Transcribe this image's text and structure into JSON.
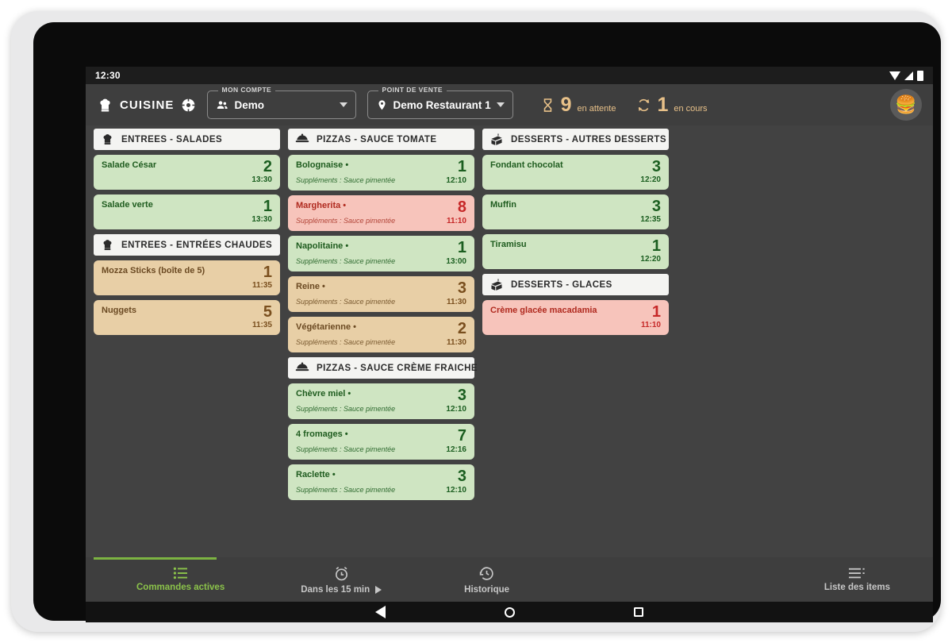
{
  "status_bar": {
    "clock": "12:30",
    "icons": [
      "wifi-icon",
      "signal-icon",
      "battery-icon"
    ]
  },
  "header": {
    "brand": "CUISINE",
    "brand_icon": "chef-hat-icon",
    "status_icon": "connection-target-icon",
    "account": {
      "label": "MON COMPTE",
      "value": "Demo",
      "icon": "people-icon"
    },
    "point_of_sale": {
      "label": "POINT DE VENTE",
      "value": "Demo Restaurant 1",
      "icon": "location-pin-icon"
    },
    "counters": [
      {
        "icon": "hourglass-icon",
        "count": "9",
        "caption": "en attente"
      },
      {
        "icon": "refresh-cycle-icon",
        "count": "1",
        "caption": "en cours"
      }
    ],
    "avatar": "🍔",
    "accent_color": "#e8c189"
  },
  "board": {
    "columns": [
      {
        "sections": [
          {
            "title": "ENTREES - SALADES",
            "icon": "chef-hat-icon",
            "cards": [
              {
                "name": "Salade César",
                "qty": "2",
                "time": "13:30",
                "supplements": "",
                "status": "green"
              },
              {
                "name": "Salade verte",
                "qty": "1",
                "time": "13:30",
                "supplements": "",
                "status": "green"
              }
            ]
          },
          {
            "title": "ENTREES - ENTRÉES CHAUDES",
            "icon": "chef-hat-icon",
            "cards": [
              {
                "name": "Mozza Sticks (boîte de 5)",
                "qty": "1",
                "time": "11:35",
                "supplements": "",
                "status": "tan"
              },
              {
                "name": "Nuggets",
                "qty": "5",
                "time": "11:35",
                "supplements": "",
                "status": "tan"
              }
            ]
          }
        ]
      },
      {
        "sections": [
          {
            "title": "PIZZAS - SAUCE TOMATE",
            "icon": "food-cloche-icon",
            "cards": [
              {
                "name": "Bolognaise •",
                "qty": "1",
                "time": "12:10",
                "supplements": "Suppléments : Sauce pimentée",
                "status": "green"
              },
              {
                "name": "Margherita •",
                "qty": "8",
                "time": "11:10",
                "supplements": "Suppléments : Sauce pimentée",
                "status": "pink"
              },
              {
                "name": "Napolitaine •",
                "qty": "1",
                "time": "13:00",
                "supplements": "Suppléments : Sauce pimentée",
                "status": "green"
              },
              {
                "name": "Reine •",
                "qty": "3",
                "time": "11:30",
                "supplements": "Suppléments : Sauce pimentée",
                "status": "tan"
              },
              {
                "name": "Végétarienne •",
                "qty": "2",
                "time": "11:30",
                "supplements": "Suppléments : Sauce pimentée",
                "status": "tan"
              }
            ]
          },
          {
            "title": "PIZZAS - SAUCE CRÈME FRAICHE",
            "icon": "food-cloche-icon",
            "cards": [
              {
                "name": "Chèvre miel •",
                "qty": "3",
                "time": "12:10",
                "supplements": "Suppléments : Sauce pimentée",
                "status": "green"
              },
              {
                "name": "4 fromages •",
                "qty": "7",
                "time": "12:16",
                "supplements": "Suppléments : Sauce pimentée",
                "status": "green"
              },
              {
                "name": "Raclette •",
                "qty": "3",
                "time": "12:10",
                "supplements": "Suppléments : Sauce pimentée",
                "status": "green"
              }
            ]
          }
        ]
      },
      {
        "sections": [
          {
            "title": "DESSERTS - AUTRES DESSERTS",
            "icon": "cake-slice-icon",
            "cards": [
              {
                "name": "Fondant chocolat",
                "qty": "3",
                "time": "12:20",
                "supplements": "",
                "status": "green"
              },
              {
                "name": "Muffin",
                "qty": "3",
                "time": "12:35",
                "supplements": "",
                "status": "green"
              },
              {
                "name": "Tiramisu",
                "qty": "1",
                "time": "12:20",
                "supplements": "",
                "status": "green"
              }
            ]
          },
          {
            "title": "DESSERTS - GLACES",
            "icon": "cake-slice-icon",
            "cards": [
              {
                "name": "Crème glacée macadamia",
                "qty": "1",
                "time": "11:10",
                "supplements": "",
                "status": "pink"
              }
            ]
          }
        ]
      }
    ]
  },
  "bottom_nav": {
    "items": [
      {
        "label": "Commandes actives",
        "icon": "list-bullets-icon",
        "active": true
      },
      {
        "label": "Dans les 15 min",
        "icon": "alarm-clock-icon",
        "active": false,
        "trailing_icon": "play-triangle-icon"
      },
      {
        "label": "Historique",
        "icon": "history-clock-icon",
        "active": false
      }
    ],
    "right_item": {
      "label": "Liste des items",
      "icon": "list-lines-icon"
    },
    "active_color": "#8bc34a"
  },
  "android_nav": {
    "back": "back-triangle-icon",
    "home": "home-circle-icon",
    "recents": "recents-square-icon"
  },
  "colors": {
    "screen_bg": "#424242",
    "header_bg": "#3e3e3e",
    "card_green": "#cfe5c2",
    "card_tan": "#e8cfa6",
    "card_pink": "#f7c4bb"
  }
}
